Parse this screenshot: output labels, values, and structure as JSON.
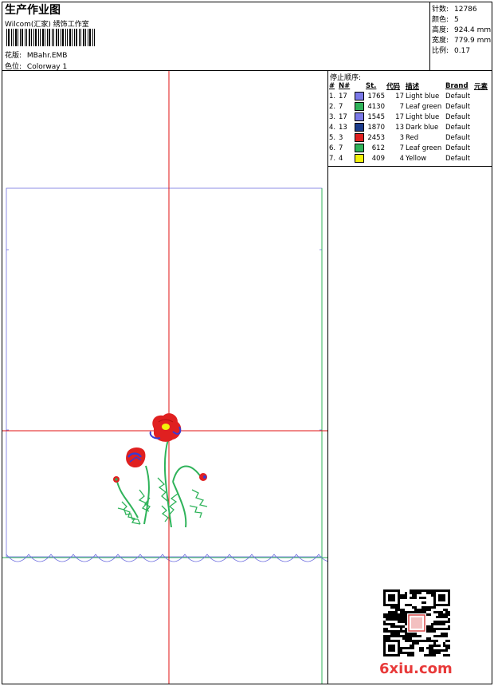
{
  "header": {
    "title": "生产作业图",
    "subtitle": "Wilcom(汇家) 绣饰工作室",
    "design_label": "花版:",
    "design_value": "MBahr.EMB",
    "colorway_label": "色位:",
    "colorway_value": "Colorway 1"
  },
  "stats": [
    {
      "label": "针数:",
      "value": "12786"
    },
    {
      "label": "颜色:",
      "value": "5"
    },
    {
      "label": "高度:",
      "value": "924.4 mm"
    },
    {
      "label": "宽度:",
      "value": "779.9 mm"
    },
    {
      "label": "比例:",
      "value": "0.17"
    }
  ],
  "color_table": {
    "title": "停止顺序:",
    "headers": [
      "#",
      "N#",
      "St.",
      "代码",
      "描述",
      "Brand",
      "元素"
    ],
    "rows": [
      {
        "idx": "1.",
        "n": "17",
        "color": "#7b79e8",
        "st": "1765",
        "code": "17",
        "desc": "Light blue",
        "brand": "Default"
      },
      {
        "idx": "2.",
        "n": "7",
        "color": "#2fb35a",
        "st": "4130",
        "code": "7",
        "desc": "Leaf green",
        "brand": "Default"
      },
      {
        "idx": "3.",
        "n": "17",
        "color": "#7b79e8",
        "st": "1545",
        "code": "17",
        "desc": "Light blue",
        "brand": "Default"
      },
      {
        "idx": "4.",
        "n": "13",
        "color": "#1b3c8c",
        "st": "1870",
        "code": "13",
        "desc": "Dark blue",
        "brand": "Default"
      },
      {
        "idx": "5.",
        "n": "3",
        "color": "#e02020",
        "st": "2453",
        "code": "3",
        "desc": "Red",
        "brand": "Default"
      },
      {
        "idx": "6.",
        "n": "7",
        "color": "#2fb35a",
        "st": "612",
        "code": "7",
        "desc": "Leaf green",
        "brand": "Default"
      },
      {
        "idx": "7.",
        "n": "4",
        "color": "#f2f20a",
        "st": "409",
        "code": "4",
        "desc": "Yellow",
        "brand": "Default"
      }
    ]
  },
  "watermark": "6xiu.com",
  "colors": {
    "crosshair": "#e01010",
    "frame": "#7070e0",
    "stem": "#2fb35a",
    "petal": "#e02020",
    "accent": "#3a3ad0",
    "center": "#f2f20a"
  },
  "icons": [
    "barcode-icon",
    "qr-code-icon"
  ]
}
